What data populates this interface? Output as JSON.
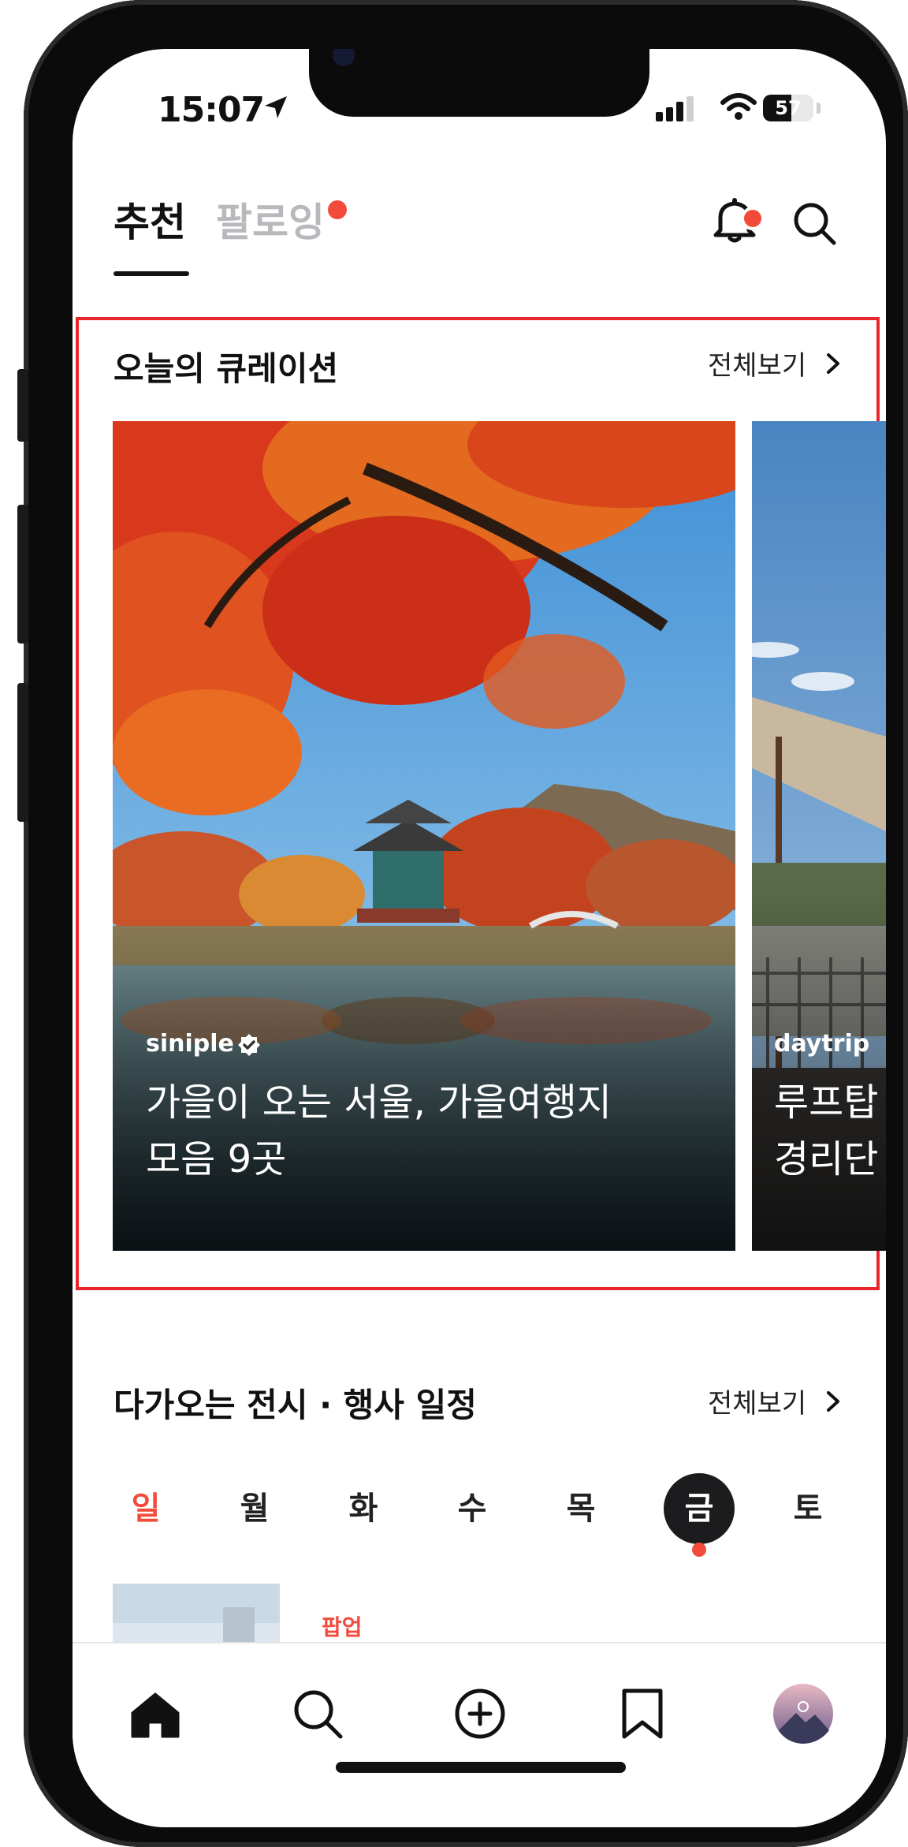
{
  "status_bar": {
    "time": "15:07",
    "battery": "57",
    "battery_level": 0.57
  },
  "top_tabs": {
    "recommended": "추천",
    "following": "팔로잉"
  },
  "curation": {
    "title": "오늘의 큐레이션",
    "see_all": "전체보기",
    "cards": [
      {
        "author": "siniple",
        "verified": true,
        "title_line1": "가을이 오는 서울, 가을여행지",
        "title_line2": "모음 9곳"
      },
      {
        "author": "daytrip",
        "verified": false,
        "title_line1": "루프탑",
        "title_line2": "경리단"
      }
    ]
  },
  "events": {
    "title": "다가오는 전시 · 행사 일정",
    "see_all": "전체보기",
    "days": [
      "일",
      "월",
      "화",
      "수",
      "목",
      "금",
      "토"
    ],
    "selected_day": "금",
    "item_category": "팝업"
  },
  "bottom_nav": {
    "items": [
      "home-icon",
      "search-icon",
      "add-circle-icon",
      "bookmark-icon",
      "profile-avatar"
    ]
  },
  "colors": {
    "accent": "#f24b3b",
    "highlight_box": "#e8262b"
  }
}
